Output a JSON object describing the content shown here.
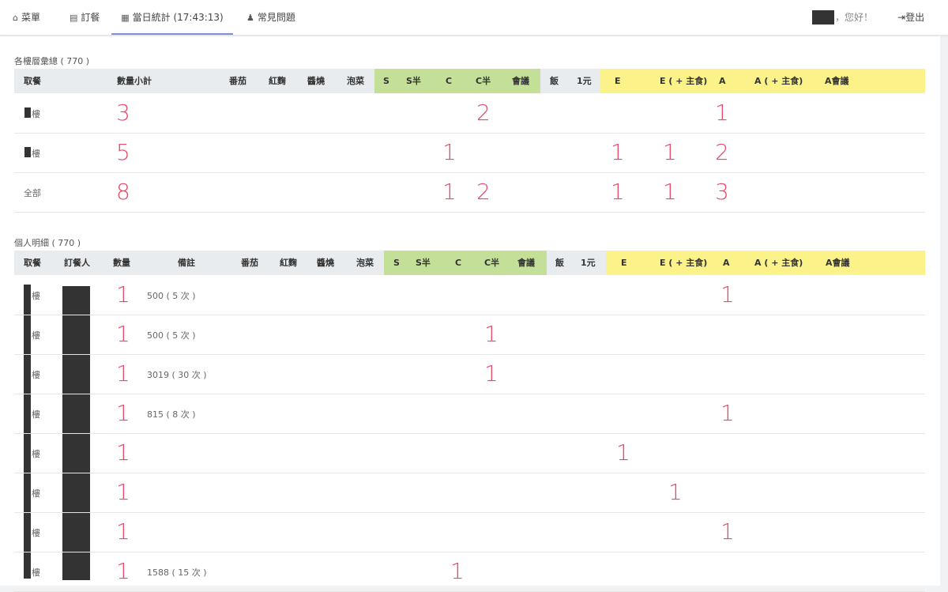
{
  "nav": {
    "tabs": [
      {
        "label": "菜單",
        "icon": "home-icon",
        "glyph": "⌂"
      },
      {
        "label": "訂餐",
        "icon": "calendar-icon",
        "glyph": "▤"
      },
      {
        "label": "當日統計 (17:43:13)",
        "icon": "stats-icon",
        "glyph": "▦"
      },
      {
        "label": "常見問題",
        "icon": "user-question-icon",
        "glyph": "♟"
      }
    ],
    "greeting": "，您好！",
    "logout": "登出",
    "logout_icon_glyph": "⇥"
  },
  "summary": {
    "title": "各樓層彙總 ( 770 )",
    "headers": [
      "取餐",
      "數量小計",
      "番茄",
      "紅麴",
      "醬燒",
      "泡菜",
      "S",
      "S半",
      "C",
      "C半",
      "會議",
      "飯",
      "1元",
      "E",
      "E ( + 主食)",
      "A",
      "A ( + 主食)",
      "A會議"
    ],
    "rows": [
      {
        "label": "樓",
        "total": "3",
        "values": {
          "C半": "2",
          "A": "1"
        }
      },
      {
        "label": "樓",
        "total": "5",
        "values": {
          "C": "1",
          "E": "1",
          "E ( + 主食)": "1",
          "A": "2"
        }
      },
      {
        "label": "全部",
        "total": "8",
        "values": {
          "C": "1",
          "C半": "2",
          "E": "1",
          "E ( + 主食)": "1",
          "A": "3"
        }
      }
    ]
  },
  "detail": {
    "title": "個人明細 ( 770 )",
    "headers": [
      "取餐",
      "訂餐人",
      "數量",
      "備註",
      "番茄",
      "紅麴",
      "醬燒",
      "泡菜",
      "S",
      "S半",
      "C",
      "C半",
      "會議",
      "飯",
      "1元",
      "E",
      "E ( + 主食)",
      "A",
      "A ( + 主食)",
      "A會議"
    ],
    "rows": [
      {
        "pickup": "樓",
        "qty": "1",
        "note": "500 ( 5 次 )",
        "col": "A"
      },
      {
        "pickup": "樓",
        "qty": "1",
        "note": "500 ( 5 次 )",
        "col": "C半"
      },
      {
        "pickup": "樓",
        "qty": "1",
        "note": "3019 ( 30 次 )",
        "col": "C半"
      },
      {
        "pickup": "樓",
        "qty": "1",
        "note": "815 ( 8 次 )",
        "col": "A"
      },
      {
        "pickup": "樓",
        "qty": "1",
        "note": "",
        "col": "E"
      },
      {
        "pickup": "樓",
        "qty": "1",
        "note": "",
        "col": "E ( + 主食)"
      },
      {
        "pickup": "樓",
        "qty": "1",
        "note": "",
        "col": "A"
      },
      {
        "pickup": "樓",
        "qty": "1",
        "note": "1588 ( 15 次 )",
        "col": "C"
      }
    ]
  },
  "colors": {
    "green": "#c4df98",
    "yellow": "#fbf38a",
    "accent": "#e84a6a",
    "tab_underline": "#7d8fd6"
  }
}
